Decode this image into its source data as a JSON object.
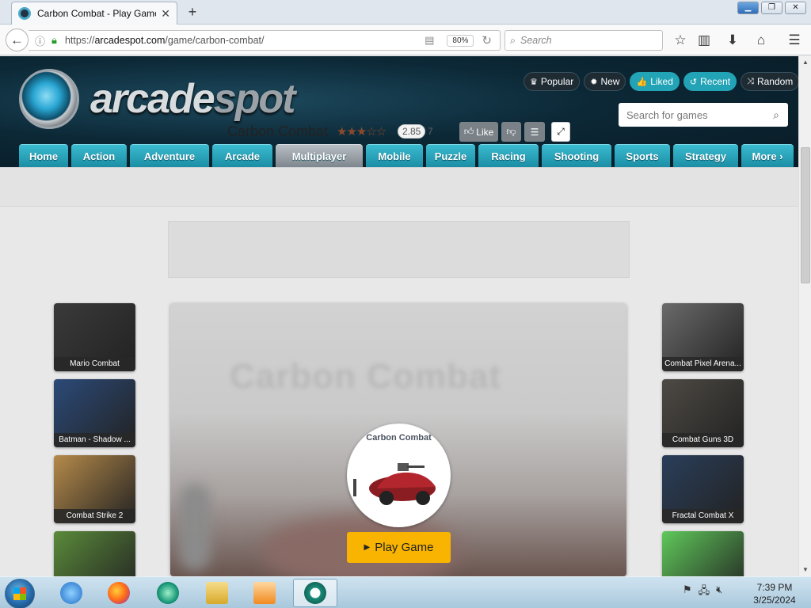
{
  "browser": {
    "tab_title": "Carbon Combat - Play Game Online",
    "tab_close": "✕",
    "new_tab": "+",
    "url_prefix": "https://",
    "url_domain": "arcadespot.com",
    "url_path": "/game/carbon-combat/",
    "zoom": "80%",
    "search_placeholder": "Search",
    "window_buttons": [
      "minimize",
      "restore",
      "close"
    ]
  },
  "site": {
    "logo_main": "arcade",
    "logo_accent": "spot",
    "header_buttons": [
      {
        "label": "Popular",
        "icon": "crown-icon",
        "glyph": "♛",
        "active": false
      },
      {
        "label": "New",
        "icon": "burst-icon",
        "glyph": "✹",
        "active": false
      },
      {
        "label": "Liked",
        "icon": "thumbs-up-icon",
        "glyph": "👍",
        "active": true
      },
      {
        "label": "Recent",
        "icon": "history-icon",
        "glyph": "↺",
        "active": true
      },
      {
        "label": "Random",
        "icon": "shuffle-icon",
        "glyph": "⤨",
        "active": false
      }
    ],
    "search_placeholder": "Search for games",
    "categories": [
      "Home",
      "Action",
      "Adventure",
      "Arcade",
      "Multiplayer",
      "Mobile",
      "Puzzle",
      "Racing",
      "Shooting",
      "Sports",
      "Strategy",
      "More ›"
    ],
    "active_category": "Multiplayer"
  },
  "game": {
    "title": "Carbon Combat",
    "stars": "★★★☆☆",
    "rating": "2.85",
    "votes": "7",
    "like_label": "Like",
    "blurred_title": "Carbon Combat",
    "icon_title": "Carbon Combat",
    "play_label": "Play Game"
  },
  "related_left": [
    {
      "title": "Mario Combat",
      "color": "#3a3a3a"
    },
    {
      "title": "Batman - Shadow ...",
      "color": "#2b4a78"
    },
    {
      "title": "Combat Strike 2",
      "color": "#b58a4a"
    },
    {
      "title": "",
      "color": "#5a8a3a"
    }
  ],
  "related_right": [
    {
      "title": "Combat Pixel Arena...",
      "color": "#6a6a6a"
    },
    {
      "title": "Combat Guns 3D",
      "color": "#4e4a44"
    },
    {
      "title": "Fractal Combat X",
      "color": "#2a3e5a"
    },
    {
      "title": "",
      "color": "#5fc85a"
    }
  ],
  "taskbar": {
    "time": "7:39 PM",
    "date": "3/25/2024",
    "apps": [
      "internet-explorer-icon",
      "firefox-icon",
      "arcadespot-icon",
      "file-explorer-icon",
      "media-player-icon",
      "arcadespot-active-icon"
    ]
  },
  "colors": {
    "accent": "#23a3b6",
    "play_button": "#f8b400",
    "header_bg": "#0c2836"
  }
}
